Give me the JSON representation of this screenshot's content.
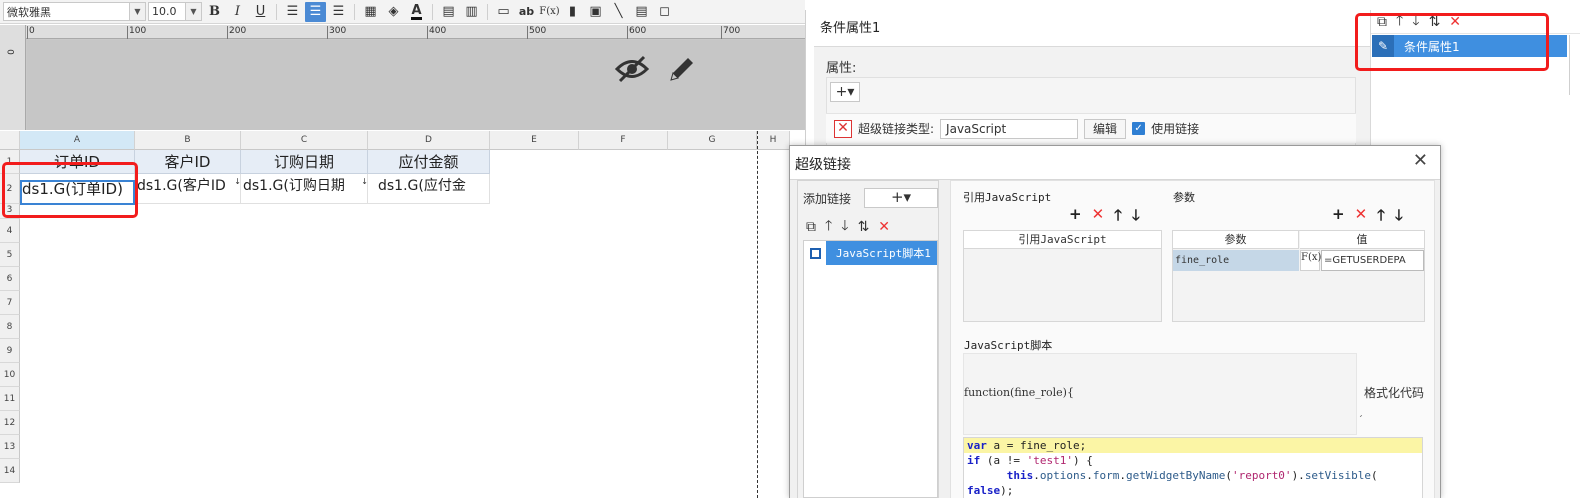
{
  "toolbar": {
    "font_name": "微软雅黑",
    "font_size": "10.0",
    "bold": "B",
    "italic": "I",
    "underline": "U",
    "text_label": "ab",
    "formula_label": "F(x)",
    "font_color": "A"
  },
  "ruler": {
    "ticks": [
      "0",
      "100",
      "200",
      "300",
      "400",
      "500",
      "600",
      "700"
    ],
    "left_tick": "0"
  },
  "sheet": {
    "columns": [
      "A",
      "B",
      "C",
      "D",
      "E",
      "F",
      "G",
      "H"
    ],
    "rows": [
      "1",
      "2",
      "3",
      "4",
      "5",
      "6",
      "7",
      "8",
      "9",
      "10",
      "11",
      "12",
      "13",
      "14"
    ],
    "header_row": [
      "订单ID",
      "客户ID",
      "订购日期",
      "应付金额"
    ],
    "data_row": [
      "ds1.G(订单ID)",
      "ds1.G(客户ID",
      "ds1.G(订购日期",
      "ds1.G(应付金"
    ],
    "expand_marker": "↓"
  },
  "condition_panel": {
    "title": "条件属性1",
    "attr_label": "属性:",
    "add_button": "+▾",
    "link_type_label": "超级链接类型:",
    "link_type_value": "JavaScript",
    "edit_button": "编辑",
    "use_link_label": "使用链接",
    "use_link_checked": true
  },
  "list_panel": {
    "item": "条件属性1"
  },
  "dialog": {
    "title": "超级链接",
    "add_link_label": "添加链接",
    "add_link_button": "+▾",
    "script_item": "JavaScript脚本1",
    "ref_js_label": "引用JavaScript",
    "ref_js_header": "引用JavaScript",
    "params_label": "参数",
    "param_col": "参数",
    "value_col": "值",
    "param_name": "fine_role",
    "param_fx": "F(x)",
    "param_value": "=GETUSERDEPA",
    "js_script_label": "JavaScript脚本",
    "function_signature": "function(fine_role){",
    "format_code": "格式化代码",
    "code_lines": [
      "var a = fine_role;",
      "if (a != 'test1') {",
      "      this.options.form.getWidgetByName('report0').setVisible(",
      "false);"
    ]
  },
  "colors": {
    "accent": "#3f8fe0",
    "highlight_red": "#f21c1c",
    "code_highlight": "#fbf5a5"
  }
}
